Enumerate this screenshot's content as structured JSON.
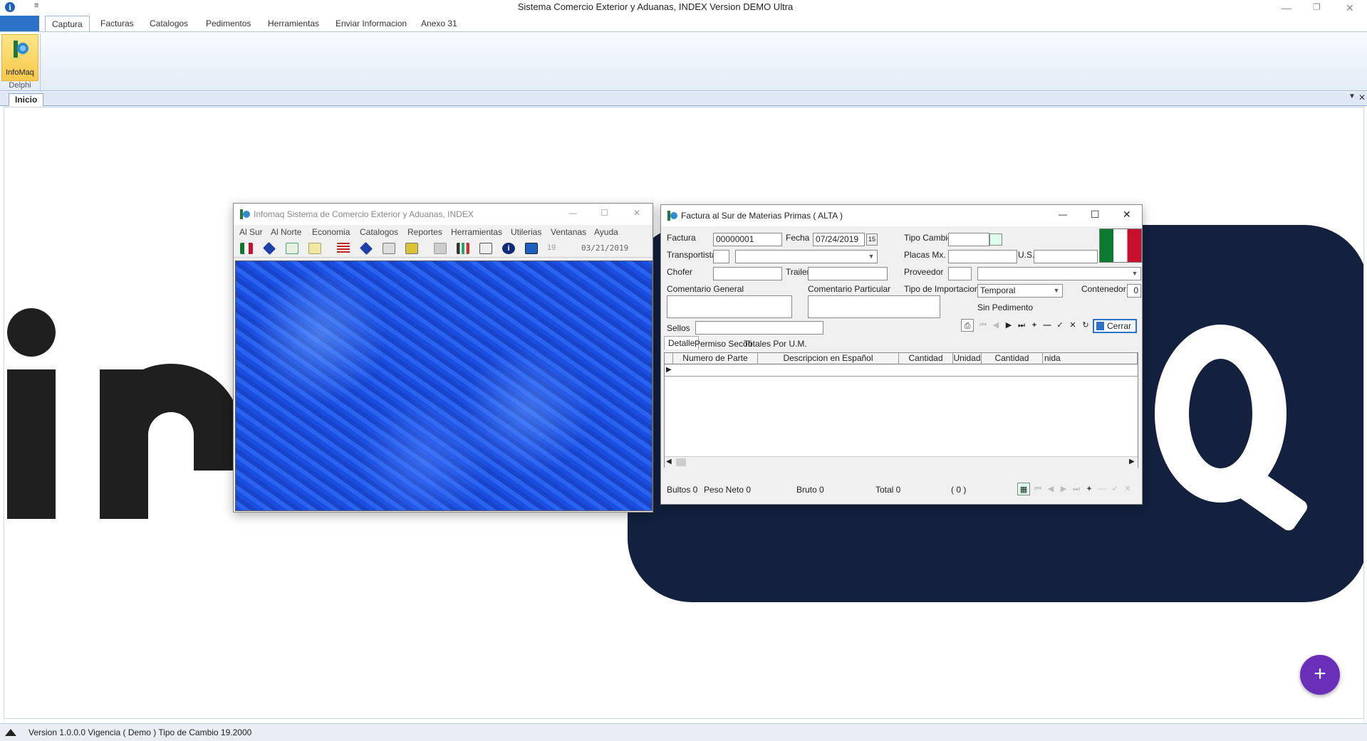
{
  "app": {
    "title": "Sistema Comercio Exterior y Aduanas, INDEX Version DEMO  Ultra",
    "quick_access": "≡"
  },
  "ribbon": {
    "tabs": [
      "Captura",
      "Facturas",
      "Catalogos",
      "Pedimentos",
      "Herramientas",
      "Enviar Informacion",
      "Anexo 31"
    ],
    "button_label": "InfoMaq",
    "group_label": "Delphi"
  },
  "doc_tabs": {
    "active": "Inicio"
  },
  "status": {
    "text": "Version 1.0.0.0  Vigencia ( Demo )  Tipo de Cambio 19.2000"
  },
  "colors": {
    "accent": "#2b73c9",
    "navy": "#13213f",
    "fab": "#6a2fb8",
    "texture": "#1f55e6"
  },
  "win1": {
    "title": "Infomaq Sistema de Comercio Exterior y Aduanas, INDEX",
    "menu": [
      "Al Sur",
      "Al Norte",
      "Economia",
      "Catalogos",
      "Reportes",
      "Herramientas",
      "Utilerias",
      "Ventanas",
      "Ayuda"
    ],
    "toolbar_number": "19",
    "date": "03/21/2019"
  },
  "win2": {
    "title": "Factura al Sur de Materias Primas ( ALTA )",
    "labels": {
      "factura": "Factura",
      "fecha": "Fecha",
      "tipo_cambio": "Tipo Cambio",
      "transportista": "Transportista",
      "placas": "Placas Mx.",
      "us": "U.S.",
      "chofer": "Chofer",
      "trailer": "Trailer",
      "proveedor": "Proveedor",
      "comentario_general": "Comentario General",
      "comentario_particular": "Comentario Particular",
      "tipo_importacion": "Tipo de Importacion",
      "contenedor": "Contenedor",
      "sin_pedimento": "Sin Pedimento",
      "sellos": "Sellos",
      "cerrar": "Cerrar"
    },
    "values": {
      "factura": "00000001",
      "fecha": "07/24/2019",
      "tipo_importacion": "Temporal",
      "contenedor": "0"
    },
    "tabs": [
      "Detalle",
      "Permiso Secofi",
      "Totales Por U.M."
    ],
    "grid_headers": [
      "Numero de Parte",
      "Descripcion en Español",
      "Cantidad Entrada",
      "Unidad",
      "Cantidad Pedimento",
      "nida"
    ],
    "totals": {
      "bultos": "Bultos 0",
      "peso_neto": "Peso Neto  0",
      "bruto": "Bruto   0",
      "total": "Total  0",
      "count": "( 0 )"
    }
  }
}
